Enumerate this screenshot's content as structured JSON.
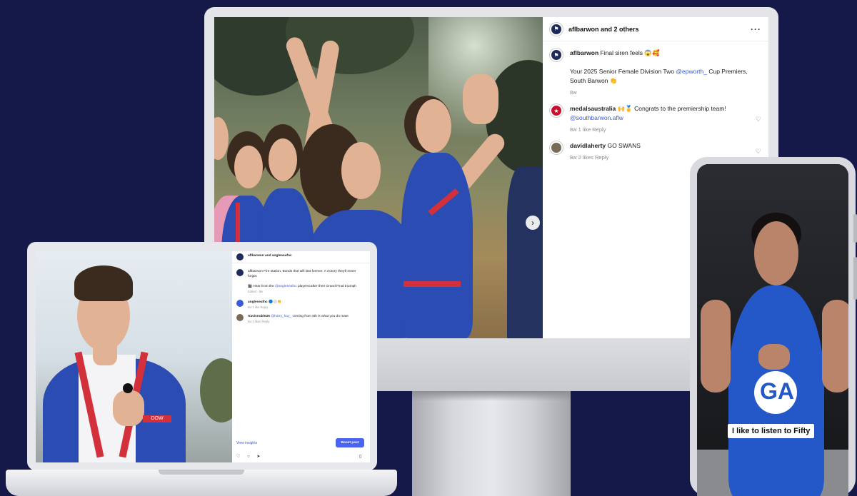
{
  "imac": {
    "post": {
      "header_user": "aflbarwon and 2 others",
      "more": "···",
      "caption_user": "aflbarwon",
      "caption_line1": "Final siren feels 😱🥰",
      "caption_line2_pre": "Your 2025 Senior Female Division Two ",
      "caption_mention": "@epworth_",
      "caption_line2_post": " Cup Premiers, South Barwon 👏",
      "caption_time": "8w",
      "comments": [
        {
          "user": "medalsaustralia",
          "text_pre": "🙌🥇 Congrats to the premiership team! ",
          "mention": "@southbarwon.aflw",
          "meta": "8w   1 like   Reply"
        },
        {
          "user": "davidlaherty",
          "text_pre": "GO SWANS",
          "mention": "",
          "meta": "8w   2 likes   Reply"
        }
      ],
      "heart": "♡",
      "next": "›"
    }
  },
  "laptop": {
    "post": {
      "header_user": "aflbarwon and angleseafnc",
      "caption": "aflbarwon Fire station. Bonds that will last forever. A victory they'll never forget.",
      "caption2_pre": "🎬 Hear from the ",
      "caption2_mention": "@angleseafnc",
      "caption2_post": " playerscafter their Grand Final triumph",
      "caption_meta": "Edited · 8w",
      "comments": [
        {
          "user": "angleseafnc",
          "text": "🔵⚪👏",
          "meta": "8w   1 like   Reply"
        },
        {
          "user": "travisnoble25",
          "text_pre": "",
          "mention": "@harry_hoy_",
          "text_post": " coming from 5th is what you do mate",
          "meta": "8w   2 likes   Reply"
        }
      ],
      "insights": "View insights",
      "boost": "Boost post",
      "icons": "♡ ○ ➤",
      "bookmark": "▯"
    }
  },
  "phone": {
    "caption": "I like to listen to Fifty",
    "jersey": "GA"
  },
  "colors": {
    "background": "#15194a",
    "team_blue": "#2b4cb2",
    "link": "#3b5bdb",
    "boost": "#4a63f0"
  }
}
